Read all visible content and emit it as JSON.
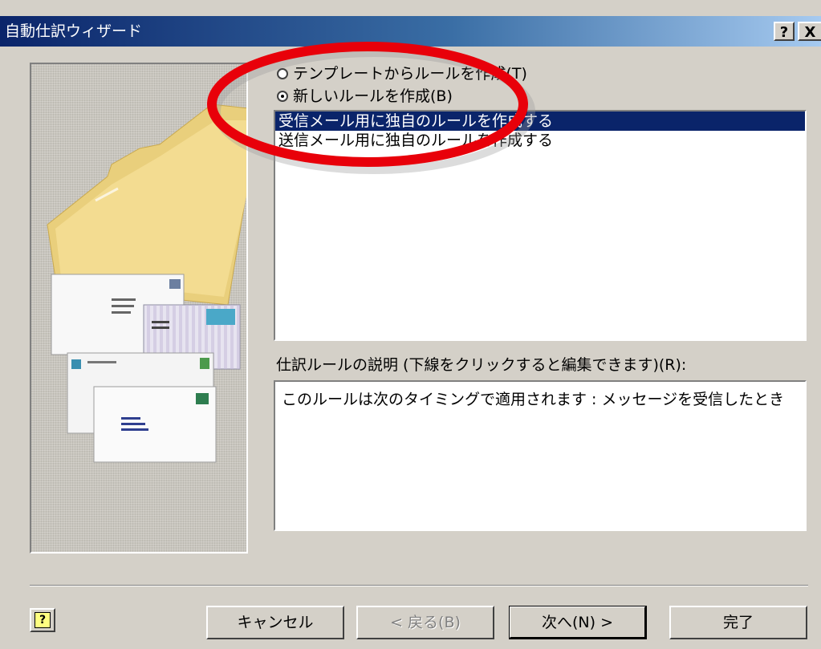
{
  "window": {
    "title": "自動仕訳ウィザード",
    "help_button": "?",
    "close_button": "X"
  },
  "rule_source": {
    "from_template_label": "テンプレートからルールを作成(T)",
    "new_rule_label": "新しいルールを作成(B)",
    "selected": "new_rule"
  },
  "rule_list": {
    "items": [
      {
        "label": "受信メール用に独自のルールを作成する",
        "selected": true
      },
      {
        "label": "送信メール用に独自のルールを作成する",
        "selected": false
      }
    ]
  },
  "description": {
    "label": "仕訳ルールの説明 (下線をクリックすると編集できます)(R):",
    "text": "このルールは次のタイミングで適用されます : メッセージを受信したとき"
  },
  "buttons": {
    "cancel": "キャンセル",
    "back": "< 戻る(B)",
    "next": "次へ(N) >",
    "finish": "完了"
  },
  "footer": {
    "help_icon": "?"
  },
  "annotation": {
    "color": "#e8000a",
    "shape": "ellipse"
  }
}
